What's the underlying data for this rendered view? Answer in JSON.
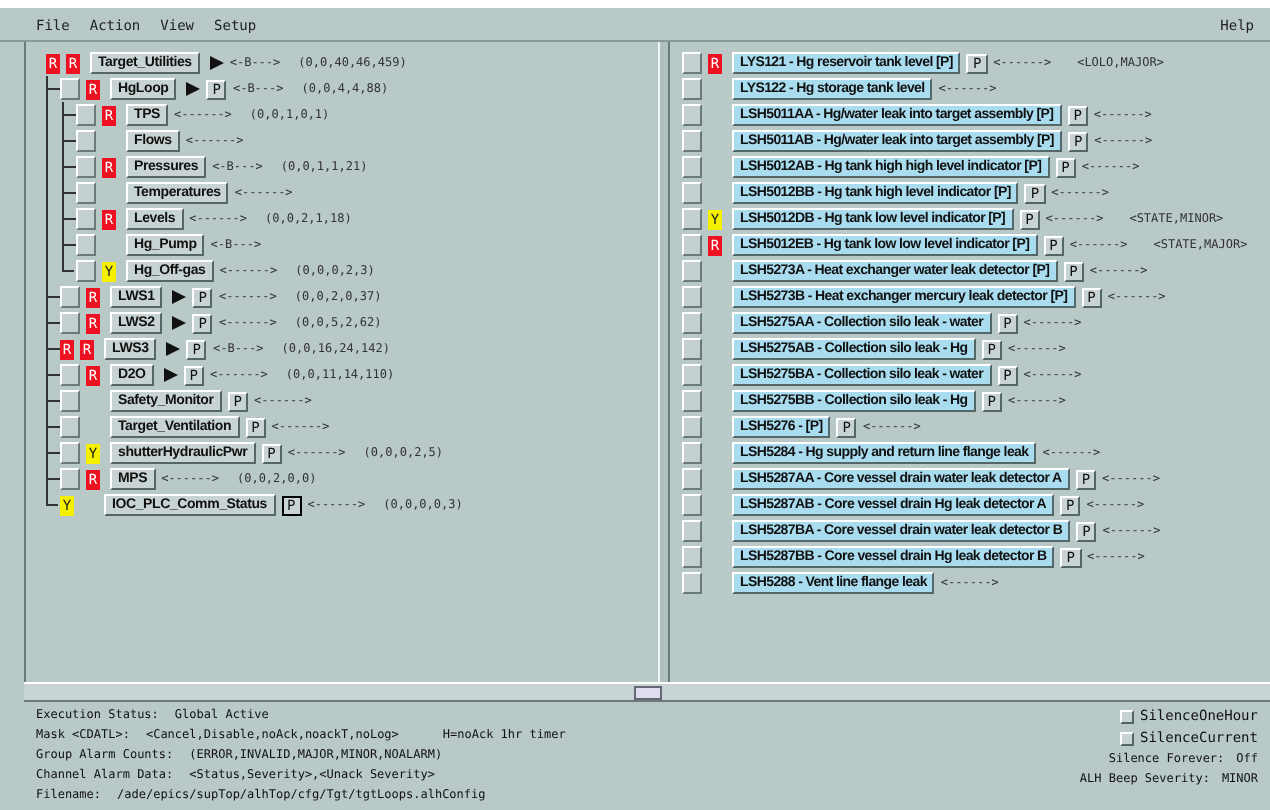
{
  "menu": {
    "items": [
      "File",
      "Action",
      "View",
      "Setup"
    ],
    "help": "Help"
  },
  "tree": [
    {
      "label": "Target_Utilities",
      "ack": {
        "letter": "R",
        "color": "#ee1122"
      },
      "alarm": {
        "letter": "R",
        "color": "#ee1122"
      },
      "arrow": true,
      "counter": "<-B--->",
      "counts": "(0,0,40,46,459)",
      "children": [
        {
          "label": "HgLoop",
          "ack": {
            "checked": false
          },
          "alarm": {
            "letter": "R",
            "color": "#ee1122"
          },
          "arrow": true,
          "p": {
            "label": "P",
            "selected": false
          },
          "counter": "<-B--->",
          "counts": "(0,0,4,4,88)",
          "children": [
            {
              "label": "TPS",
              "ack": {
                "checked": false
              },
              "alarm": {
                "letter": "R",
                "color": "#ee1122"
              },
              "counter": "<------>",
              "counts": "(0,0,1,0,1)"
            },
            {
              "label": "Flows",
              "ack": {
                "checked": false
              },
              "counter": "<------>"
            },
            {
              "label": "Pressures",
              "ack": {
                "checked": false
              },
              "alarm": {
                "letter": "R",
                "color": "#ee1122"
              },
              "counter": "<-B--->",
              "counts": "(0,0,1,1,21)"
            },
            {
              "label": "Temperatures",
              "ack": {
                "checked": false
              },
              "counter": "<------>"
            },
            {
              "label": "Levels",
              "ack": {
                "checked": false
              },
              "alarm": {
                "letter": "R",
                "color": "#ee1122"
              },
              "counter": "<------>",
              "counts": "(0,0,2,1,18)"
            },
            {
              "label": "Hg_Pump",
              "ack": {
                "checked": false
              },
              "counter": "<-B--->"
            },
            {
              "label": "Hg_Off-gas",
              "ack": {
                "checked": false
              },
              "alarm": {
                "letter": "Y",
                "color": "#f4f000"
              },
              "counter": "<------>",
              "counts": "(0,0,0,2,3)"
            }
          ]
        },
        {
          "label": "LWS1",
          "ack": {
            "checked": false
          },
          "alarm": {
            "letter": "R",
            "color": "#ee1122"
          },
          "arrow": true,
          "p": {
            "label": "P",
            "selected": false
          },
          "counter": "<------>",
          "counts": "(0,0,2,0,37)"
        },
        {
          "label": "LWS2",
          "ack": {
            "checked": false
          },
          "alarm": {
            "letter": "R",
            "color": "#ee1122"
          },
          "arrow": true,
          "p": {
            "label": "P",
            "selected": false
          },
          "counter": "<------>",
          "counts": "(0,0,5,2,62)"
        },
        {
          "label": "LWS3",
          "ack": {
            "letter": "R",
            "color": "#ee1122"
          },
          "alarm": {
            "letter": "R",
            "color": "#ee1122"
          },
          "arrow": true,
          "p": {
            "label": "P",
            "selected": false
          },
          "counter": "<-B--->",
          "counts": "(0,0,16,24,142)"
        },
        {
          "label": "D2O",
          "ack": {
            "checked": false
          },
          "alarm": {
            "letter": "R",
            "color": "#ee1122"
          },
          "arrow": true,
          "p": {
            "label": "P",
            "selected": false
          },
          "counter": "<------>",
          "counts": "(0,0,11,14,110)"
        },
        {
          "label": "Safety_Monitor",
          "ack": {
            "checked": false
          },
          "p": {
            "label": "P",
            "selected": false
          },
          "counter": "<------>"
        },
        {
          "label": "Target_Ventilation",
          "ack": {
            "checked": false
          },
          "p": {
            "label": "P",
            "selected": false
          },
          "counter": "<------>"
        },
        {
          "label": "shutterHydraulicPwr",
          "ack": {
            "checked": false
          },
          "alarm": {
            "letter": "Y",
            "color": "#f4f000"
          },
          "p": {
            "label": "P",
            "selected": false
          },
          "counter": "<------>",
          "counts": "(0,0,0,2,5)"
        },
        {
          "label": "MPS",
          "ack": {
            "checked": false
          },
          "alarm": {
            "letter": "R",
            "color": "#ee1122"
          },
          "counter": "<------>",
          "counts": "(0,0,2,0,0)"
        },
        {
          "label": "IOC_PLC_Comm_Status",
          "ack": {
            "letter": "Y",
            "color": "#f4f000"
          },
          "p": {
            "label": "P",
            "selected": true
          },
          "counter": "<------>",
          "counts": "(0,0,0,0,3)"
        }
      ]
    }
  ],
  "channels": [
    {
      "label": "LYS121 - Hg reservoir tank level [P]",
      "ack": {
        "checked": false
      },
      "alarm": {
        "letter": "R",
        "color": "#ee1122"
      },
      "p": "P",
      "counter": "<------>",
      "status": "<LOLO,MAJOR>"
    },
    {
      "label": "LYS122 - Hg storage tank level",
      "ack": {
        "checked": false
      },
      "counter": "<------>"
    },
    {
      "label": "LSH5011AA - Hg/water leak into target assembly [P]",
      "ack": {
        "checked": false
      },
      "p": "P",
      "counter": "<------>"
    },
    {
      "label": "LSH5011AB - Hg/water leak into target assembly [P]",
      "ack": {
        "checked": false
      },
      "p": "P",
      "counter": "<------>"
    },
    {
      "label": "LSH5012AB - Hg tank high high level indicator [P]",
      "ack": {
        "checked": false
      },
      "p": "P",
      "counter": "<------>"
    },
    {
      "label": "LSH5012BB - Hg tank high level indicator [P]",
      "ack": {
        "checked": false
      },
      "p": "P",
      "counter": "<------>"
    },
    {
      "label": "LSH5012DB - Hg tank low level indicator [P]",
      "ack": {
        "checked": false
      },
      "alarm": {
        "letter": "Y",
        "color": "#f4f000"
      },
      "p": "P",
      "counter": "<------>",
      "status": "<STATE,MINOR>"
    },
    {
      "label": "LSH5012EB - Hg tank low low level indicator [P]",
      "ack": {
        "checked": false
      },
      "alarm": {
        "letter": "R",
        "color": "#ee1122"
      },
      "p": "P",
      "counter": "<------>",
      "status": "<STATE,MAJOR>"
    },
    {
      "label": "LSH5273A - Heat exchanger water leak detector [P]",
      "ack": {
        "checked": false
      },
      "p": "P",
      "counter": "<------>"
    },
    {
      "label": "LSH5273B - Heat exchanger mercury leak detector [P]",
      "ack": {
        "checked": false
      },
      "p": "P",
      "counter": "<------>"
    },
    {
      "label": "LSH5275AA - Collection silo leak - water",
      "ack": {
        "checked": false
      },
      "p": "P",
      "counter": "<------>"
    },
    {
      "label": "LSH5275AB - Collection silo leak - Hg",
      "ack": {
        "checked": false
      },
      "p": "P",
      "counter": "<------>"
    },
    {
      "label": "LSH5275BA - Collection silo leak - water",
      "ack": {
        "checked": false
      },
      "p": "P",
      "counter": "<------>"
    },
    {
      "label": "LSH5275BB - Collection silo leak - Hg",
      "ack": {
        "checked": false
      },
      "p": "P",
      "counter": "<------>"
    },
    {
      "label": "LSH5276 - [P]",
      "ack": {
        "checked": false
      },
      "p": "P",
      "counter": "<------>"
    },
    {
      "label": "LSH5284 - Hg supply and return line flange leak",
      "ack": {
        "checked": false
      },
      "counter": "<------>"
    },
    {
      "label": "LSH5287AA - Core vessel drain water leak detector A",
      "ack": {
        "checked": false
      },
      "p": "P",
      "counter": "<------>"
    },
    {
      "label": "LSH5287AB - Core vessel drain Hg leak detector A",
      "ack": {
        "checked": false
      },
      "p": "P",
      "counter": "<------>"
    },
    {
      "label": "LSH5287BA - Core vessel drain water leak detector B",
      "ack": {
        "checked": false
      },
      "p": "P",
      "counter": "<------>"
    },
    {
      "label": "LSH5287BB - Core vessel drain Hg leak detector B",
      "ack": {
        "checked": false
      },
      "p": "P",
      "counter": "<------>"
    },
    {
      "label": "LSH5288 - Vent line flange leak",
      "ack": {
        "checked": false
      },
      "counter": "<------>"
    }
  ],
  "status": [
    {
      "label": "Execution Status:",
      "value": "Global Active"
    },
    {
      "label": "Mask <CDATL>:",
      "value": "<Cancel,Disable,noAck,noackT,noLog>",
      "extra": "H=noAck 1hr timer"
    },
    {
      "label": "Group Alarm Counts:",
      "value": "(ERROR,INVALID,MAJOR,MINOR,NOALARM)"
    },
    {
      "label": "Channel Alarm Data:",
      "value": "<Status,Severity>,<Unack Severity>"
    },
    {
      "label": "Filename:",
      "value": "/ade/epics/supTop/alhTop/cfg/Tgt/tgtLoops.alhConfig"
    }
  ],
  "silence": [
    {
      "label": "SilenceOneHour",
      "checked": false
    },
    {
      "label": "SilenceCurrent",
      "checked": false
    }
  ],
  "settings": [
    {
      "label": "Silence Forever:",
      "value": "Off"
    },
    {
      "label": "ALH Beep Severity:",
      "value": "MINOR"
    }
  ]
}
